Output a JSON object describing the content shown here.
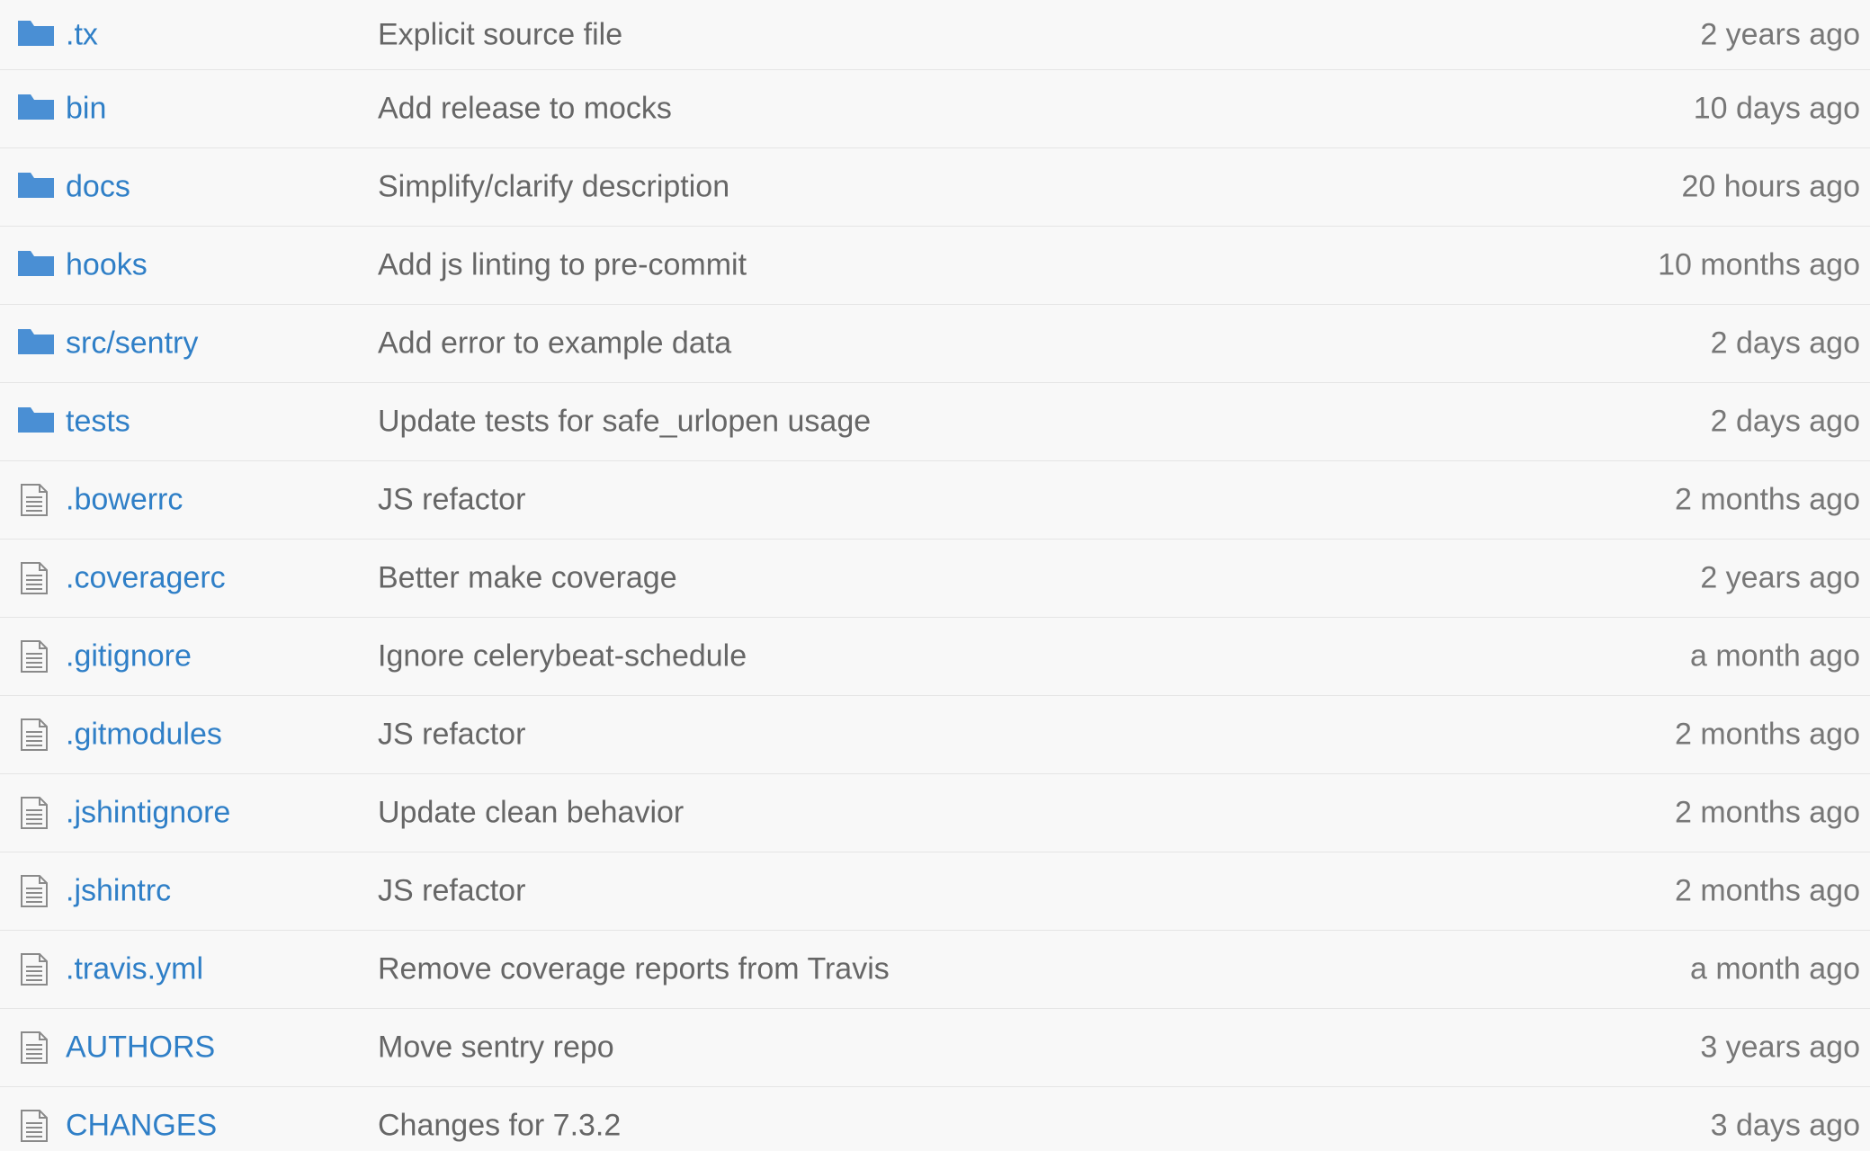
{
  "colors": {
    "link": "#2f7fc7",
    "folder_icon": "#4a8fd4",
    "file_icon": "#8a8a8a",
    "message_text": "#666666",
    "age_text": "#777777",
    "background": "#f8f8f8",
    "divider": "#e5e5e5"
  },
  "files": [
    {
      "type": "directory",
      "icon": "folder-icon",
      "name": ".tx",
      "message": "Explicit source file",
      "age": "2 years ago"
    },
    {
      "type": "directory",
      "icon": "folder-icon",
      "name": "bin",
      "message": "Add release to mocks",
      "age": "10 days ago"
    },
    {
      "type": "directory",
      "icon": "folder-icon",
      "name": "docs",
      "message": "Simplify/clarify description",
      "age": "20 hours ago"
    },
    {
      "type": "directory",
      "icon": "folder-icon",
      "name": "hooks",
      "message": "Add js linting to pre-commit",
      "age": "10 months ago"
    },
    {
      "type": "directory",
      "icon": "folder-icon",
      "name": "src/sentry",
      "message": "Add error to example data",
      "age": "2 days ago"
    },
    {
      "type": "directory",
      "icon": "folder-icon",
      "name": "tests",
      "message": "Update tests for safe_urlopen usage",
      "age": "2 days ago"
    },
    {
      "type": "file",
      "icon": "file-icon",
      "name": ".bowerrc",
      "message": "JS refactor",
      "age": "2 months ago"
    },
    {
      "type": "file",
      "icon": "file-icon",
      "name": ".coveragerc",
      "message": "Better make coverage",
      "age": "2 years ago"
    },
    {
      "type": "file",
      "icon": "file-icon",
      "name": ".gitignore",
      "message": "Ignore celerybeat-schedule",
      "age": "a month ago"
    },
    {
      "type": "file",
      "icon": "file-icon",
      "name": ".gitmodules",
      "message": "JS refactor",
      "age": "2 months ago"
    },
    {
      "type": "file",
      "icon": "file-icon",
      "name": ".jshintignore",
      "message": "Update clean behavior",
      "age": "2 months ago"
    },
    {
      "type": "file",
      "icon": "file-icon",
      "name": ".jshintrc",
      "message": "JS refactor",
      "age": "2 months ago"
    },
    {
      "type": "file",
      "icon": "file-icon",
      "name": ".travis.yml",
      "message": "Remove coverage reports from Travis",
      "age": "a month ago"
    },
    {
      "type": "file",
      "icon": "file-icon",
      "name": "AUTHORS",
      "message": "Move sentry repo",
      "age": "3 years ago"
    },
    {
      "type": "file",
      "icon": "file-icon",
      "name": "CHANGES",
      "message": "Changes for 7.3.2",
      "age": "3 days ago"
    }
  ]
}
